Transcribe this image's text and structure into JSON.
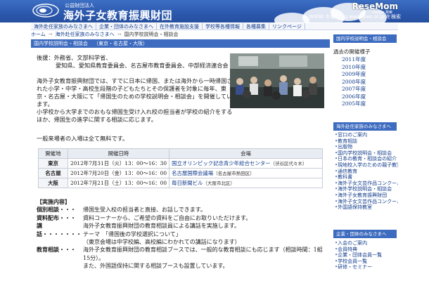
{
  "header": {
    "org_subtitle": "公益財団法人",
    "org_name": "海外子女教育振興財団",
    "search_www": "WWW を検索",
    "search_site": "www.joes.or.jp を検索",
    "brand": "ReseMom",
    "brand_sub": "Google 検索"
  },
  "topnav": [
    "海外赴任家族のみなさまへ",
    "企業・団体のみなさまへ",
    "在外教育施設支援",
    "学校等各種情報",
    "各種募集",
    "リンクページ"
  ],
  "breadcrumb": [
    "ホーム",
    "海外赴任家族のみなさまへ",
    "国内学校説明会・相談会"
  ],
  "title_bar": {
    "label": "国内学校説明会・相談会",
    "cities": "（東京・名古屋・大阪）"
  },
  "sponsors": {
    "l1": "後援：外務省、文部科学省、",
    "l2": "愛知県、愛知県教育委員会、名古屋市教育委員会、中部経済連合会"
  },
  "intro": {
    "l1": "海外子女教育振興財団では、すでに日本に帰国、または海外から一時帰国さ",
    "l2": "れた小学・中学・高校生段階の子どもたちとその保護者を対象に毎年、東",
    "l3": "京・名古屋・大阪にて「帰国生のための学校説明会・相談会」を開催してい",
    "l4": "ます。",
    "l5": "小学校から大学までのおもな帰国生受け入れ校の担当者が学校の紹介をする",
    "l6": "ほか、帰国生の進学に関する相談に応じます。"
  },
  "free_note": "一般来場者の入場は全て無料です。",
  "schedule": {
    "headers": [
      "開催地",
      "開催日時",
      "会場"
    ],
    "rows": [
      {
        "city": "東京",
        "date": "2012年7月31日（火）13：00～16：30",
        "venue": "国立オリンピック記念青少年総合センター",
        "loc": "（渋谷区代々木）"
      },
      {
        "city": "名古屋",
        "date": "2012年7月20日（金）13：00～16：00",
        "venue": "名古屋国際会議場",
        "loc": "（名古屋市熱田区）"
      },
      {
        "city": "大阪",
        "date": "2012年7月21日（土）13：00～16：00",
        "venue": "毎日新聞ビル",
        "loc": "（大阪市北区）"
      }
    ]
  },
  "details": {
    "heading": "【実施内容】",
    "rows": [
      {
        "label": "個別相談・・・",
        "val": "帰国生受入校の担当者と直接、お話しできます。"
      },
      {
        "label": "資料配布・・・",
        "val": "資料コーナーから、ご希望の資料をご自由にお取りいただけます。"
      },
      {
        "label": "講　",
        "val": "海外子女教育振興財団の教育相談員による講話を実施します。"
      },
      {
        "label": "話・・・・・・・",
        "val": "テーマ　「帰国後の学校選択について」"
      },
      {
        "label": "",
        "val": "（東京会場は中学校編、高校編にわかれての講話になります）"
      },
      {
        "label": "教育相談・・・",
        "val": "海外子女教育振興財団の教育相談ブースでは、一般的な教育相談にも応じます（相談時間：1組15分）。"
      },
      {
        "label": "",
        "val": "また、外国語保持に関する相談ブースも設置しています。"
      }
    ]
  },
  "sidebar": {
    "box1_title": "国内学校説明会・相談会",
    "past_label": "過去の開催様子",
    "years": [
      "2011年度",
      "2010年度",
      "2009年度",
      "2008年度",
      "2007年度",
      "2006年度",
      "2005年度"
    ],
    "box2_title": "海外赴任家族のみなさまへ",
    "box2_items": [
      "窓口のご案内",
      "教育相談",
      "出版物",
      "国内学校説明会・相談会",
      "日本の教育・相談会の紹介",
      "現地校入学のための親子教室",
      "通信教育",
      "教科書",
      "海外子女文芸作品コンクール",
      "海外学校説明会・相談会",
      "海外子女教育振興財団",
      "海外子女文芸作品コンクール",
      "外国語保持教室"
    ],
    "box3_title": "企業・団体のみなさまへ",
    "box3_items": [
      "入会のご案内",
      "会員特典",
      "企業・団体会員一覧",
      "学校会員一覧",
      "研修・セミナー"
    ]
  }
}
